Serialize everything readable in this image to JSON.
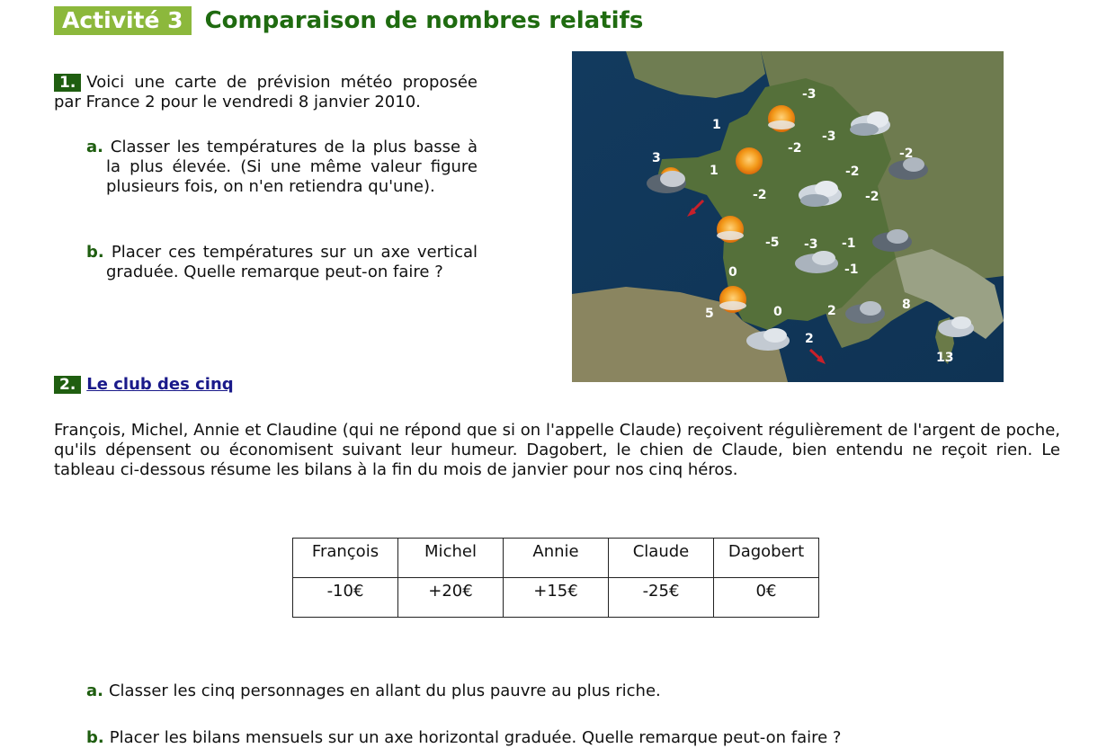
{
  "header": {
    "badge": "Activité 3",
    "title": "Comparaison de nombres relatifs"
  },
  "part1": {
    "number": "1.",
    "intro": "Voici une carte de prévision météo proposée par France 2 pour le vendredi 8 janvier 2010.",
    "a": {
      "letter": "a.",
      "text": "Classer les températures de la plus basse à la plus élevée. (Si une même valeur figure plusieurs fois, on n'en retiendra qu'une)."
    },
    "b": {
      "letter": "b.",
      "text": "Placer ces températures sur un axe vertical graduée. Quelle remarque peut-on faire ?"
    }
  },
  "map": {
    "temperatures": [
      "-3",
      "1",
      "-3",
      "-2",
      "3",
      "1",
      "-2",
      "-2",
      "-2",
      "-2",
      "-5",
      "-3",
      "-1",
      "0",
      "-1",
      "8",
      "5",
      "0",
      "2",
      "2",
      "13"
    ],
    "icons": [
      "sun-icon",
      "sun-cloud-icon",
      "cloud-icon",
      "rain-cloud-icon",
      "wind-arrow-icon"
    ]
  },
  "part2": {
    "number": "2.",
    "title": "Le club des cinq",
    "paragraph": "François, Michel, Annie et Claudine (qui ne répond que si on l'appelle Claude) reçoivent régulièrement de l'argent de poche, qu'ils dépensent ou économisent suivant leur humeur. Dagobert, le chien de Claude, bien entendu ne reçoit rien. Le tableau ci-dessous résume les bilans à la fin du mois de janvier pour nos cinq héros.",
    "table": {
      "headers": [
        "François",
        "Michel",
        "Annie",
        "Claude",
        "Dagobert"
      ],
      "values": [
        "-10€",
        "+20€",
        "+15€",
        "-25€",
        "0€"
      ]
    },
    "a": {
      "letter": "a.",
      "text": "Classer les cinq personnages en allant du plus pauvre au plus riche."
    },
    "b": {
      "letter": "b.",
      "text": "Placer les bilans mensuels sur un axe horizontal graduée. Quelle remarque peut-on faire ?"
    }
  }
}
